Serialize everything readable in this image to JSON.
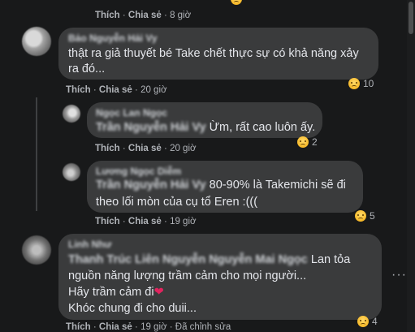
{
  "comments": [
    {
      "actions": {
        "like": "Thích",
        "share": "Chia sẻ",
        "time": "8 giờ"
      }
    },
    {
      "author": "Bảo Nguyễn Hải Vy",
      "lines": [
        "thật ra giả thuyết bé Take chết thực sự có khả năng xảy",
        "ra đó..."
      ],
      "actions": {
        "like": "Thích",
        "share": "Chia sẻ",
        "time": "20 giờ"
      },
      "reaction_count": "10"
    },
    {
      "author": "Ngọc Lan Ngọc",
      "mention": "Trần Nguyễn Hải Vy",
      "text": " Ừm, rất cao luôn ấy.",
      "actions": {
        "like": "Thích",
        "share": "Chia sẻ",
        "time": "20 giờ"
      },
      "reaction_count": "2"
    },
    {
      "author": "Lương Ngọc Diễm",
      "mention": "Trần Nguyễn Hải Vy",
      "text_line1": " 80-90% là Takemichi sẽ đi",
      "text_line2": "theo lối mòn của cụ tổ Eren :(((",
      "actions": {
        "like": "Thích",
        "share": "Chia sẻ",
        "time": "19 giờ"
      },
      "reaction_count": "5"
    },
    {
      "author": "Linh Như",
      "mention": "Thanh Trúc Liên Nguyễn Nguyễn Mai Ngọc",
      "text_line1": " Lan tỏa",
      "text_line2": "nguồn năng lượng trầm cảm cho mọi người...",
      "text_line3": "Hãy trầm cảm đi",
      "text_line4": "Khóc chung đi cho duii...",
      "actions": {
        "like": "Thích",
        "share": "Chia sẻ",
        "time": "19 giờ",
        "edited": "Đã chỉnh sửa"
      },
      "reaction_count": "4"
    }
  ],
  "more_label": "···"
}
